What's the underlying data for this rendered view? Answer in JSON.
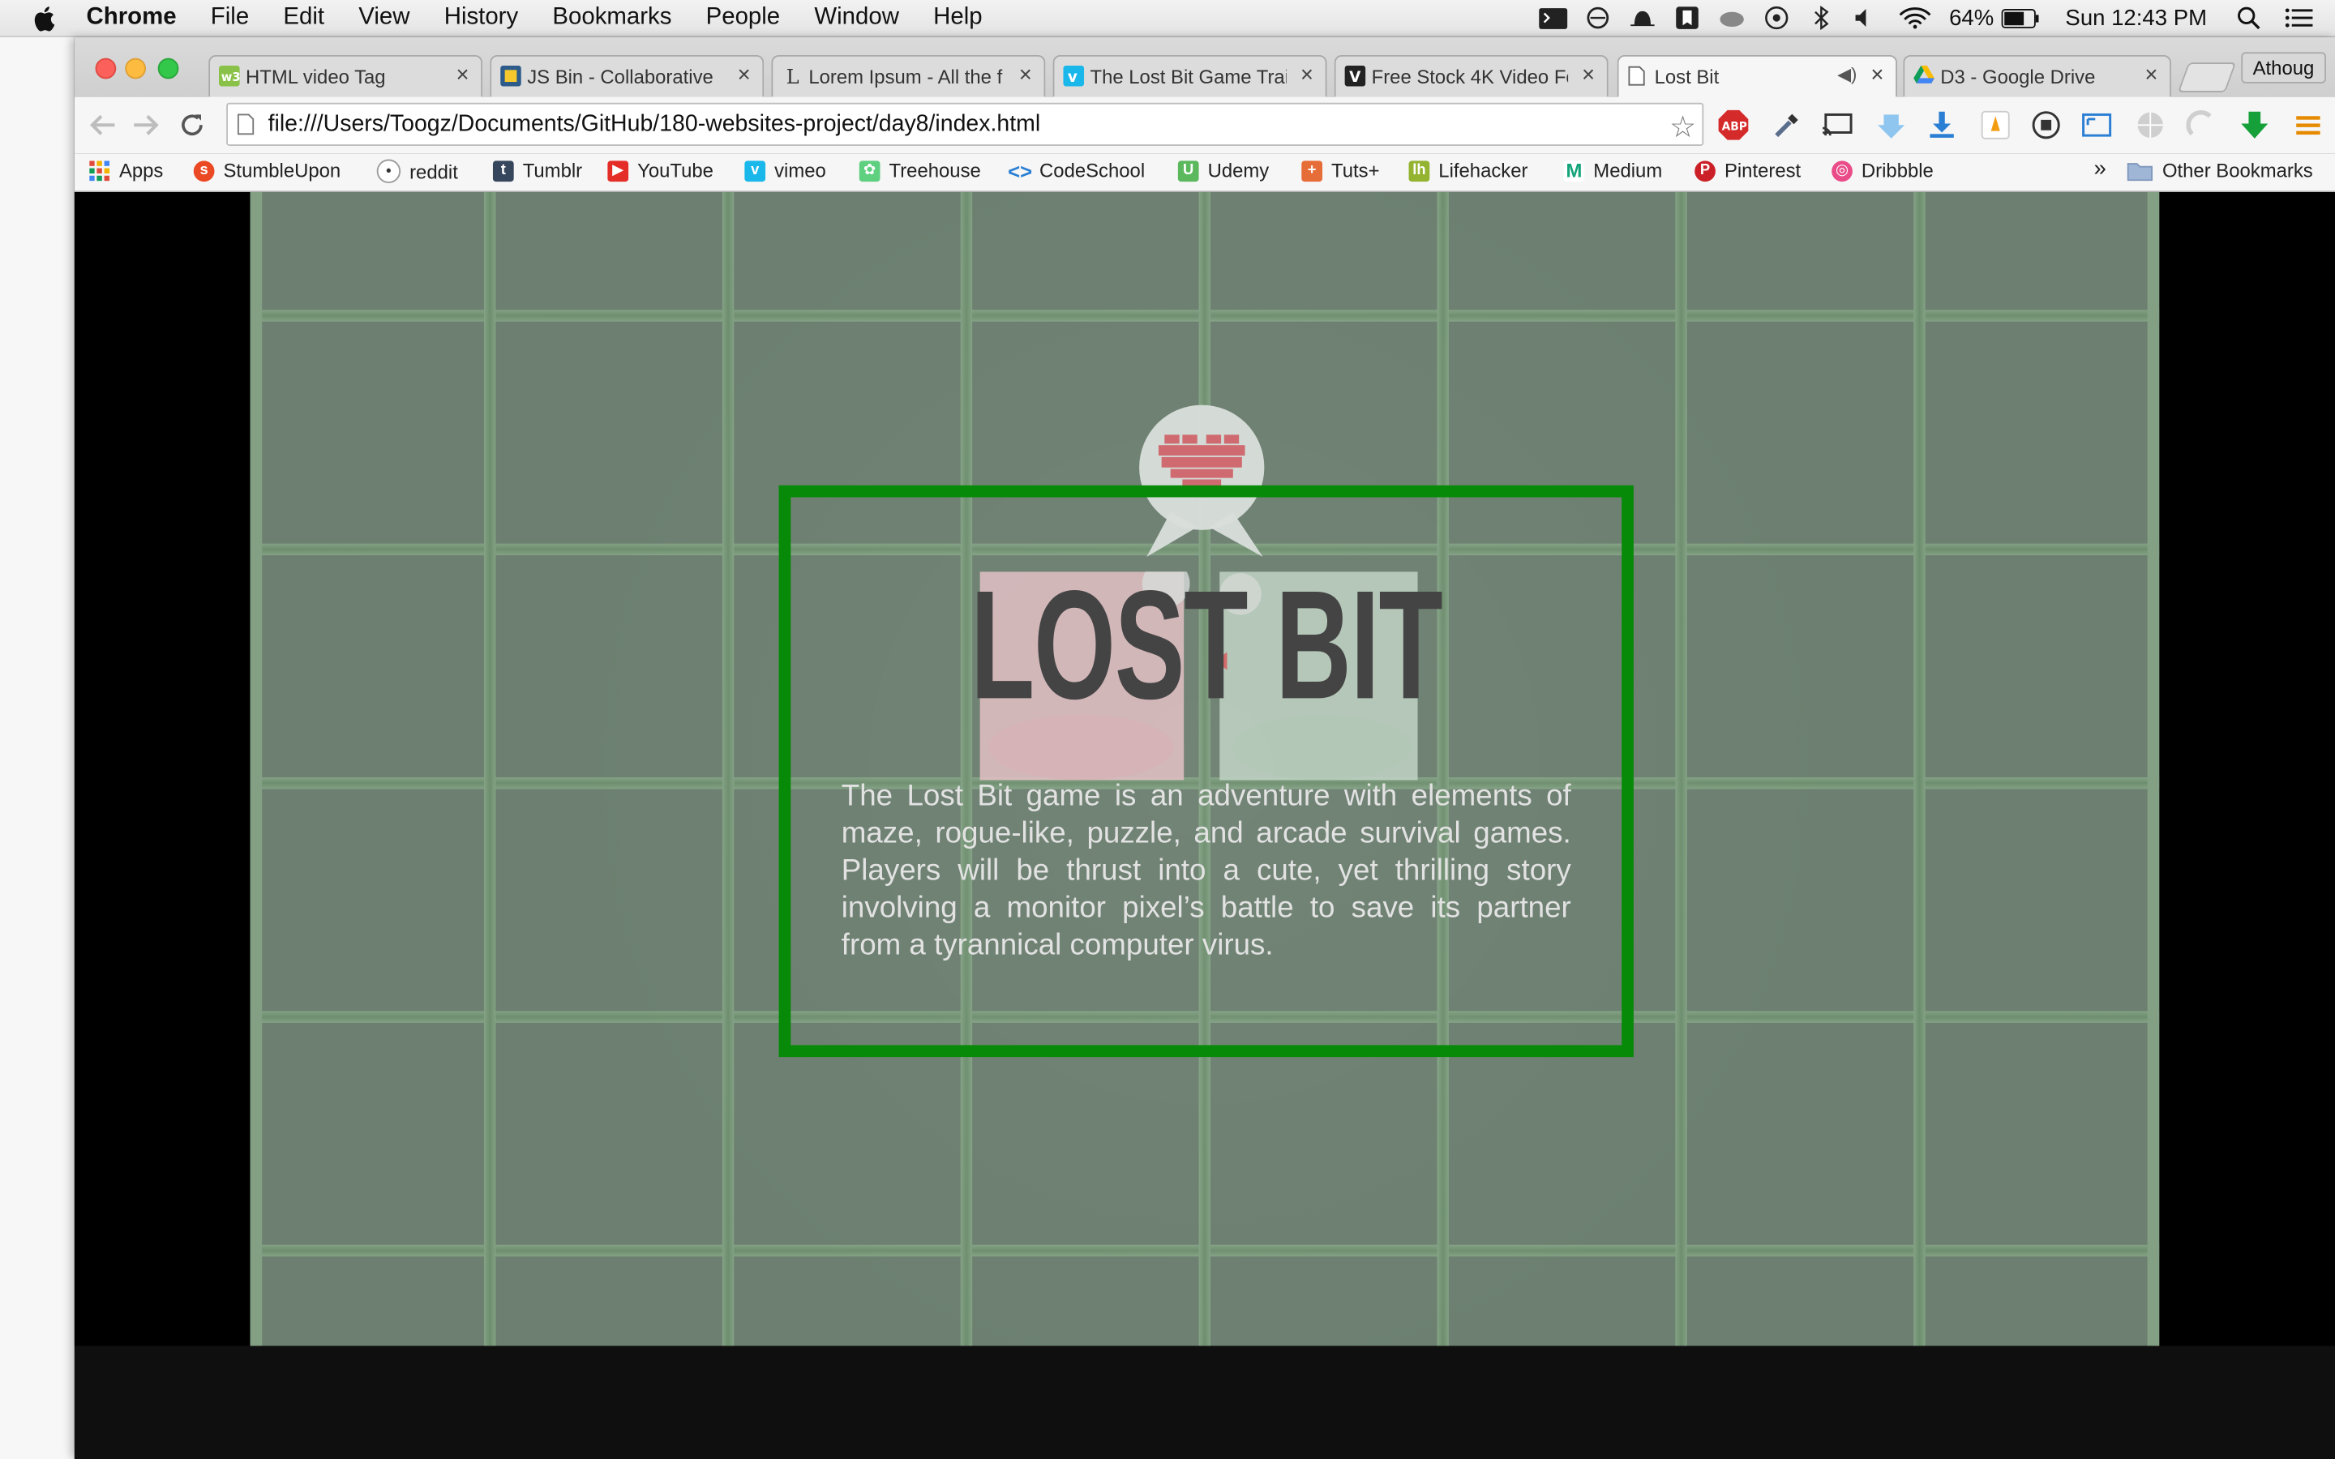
{
  "menubar": {
    "app": "Chrome",
    "items": [
      "File",
      "Edit",
      "View",
      "History",
      "Bookmarks",
      "People",
      "Window",
      "Help"
    ],
    "battery": "64%",
    "clock": "Sun 12:43 PM"
  },
  "tabs": [
    {
      "title": "HTML video Tag",
      "icon": "w3schools-icon"
    },
    {
      "title": "JS Bin - Collaborative",
      "icon": "jsbin-icon"
    },
    {
      "title": "Lorem Ipsum - All the f",
      "icon": "lipsum-icon"
    },
    {
      "title": "The Lost Bit Game Trai",
      "icon": "vimeo-icon"
    },
    {
      "title": "Free Stock 4K Video Fo",
      "icon": "videvo-icon"
    },
    {
      "title": "Lost Bit",
      "icon": "page-icon",
      "active": true
    },
    {
      "title": "D3 - Google Drive",
      "icon": "google-drive-icon"
    }
  ],
  "profile": "Athoug",
  "address": {
    "url": "file:///Users/Toogz/Documents/GitHub/180-websites-project/day8/index.html"
  },
  "bookmarks": {
    "items": [
      "Apps",
      "StumbleUpon",
      "reddit",
      "Tumblr",
      "YouTube",
      "vimeo",
      "Treehouse",
      "CodeSchool",
      "Udemy",
      "Tuts+",
      "Lifehacker",
      "Medium",
      "Pinterest",
      "Dribbble"
    ],
    "overflow": "»",
    "other": "Other Bookmarks"
  },
  "page": {
    "title": "LOST BIT",
    "description": "The Lost Bit game is an adventure with elements of maze, rogue-like, puzzle, and arcade survival games. Players will be thrust into a cute, yet thrilling story involving a monitor pixel’s battle to save its partner from a tyrannical computer virus.",
    "frame_color": "#068a07"
  }
}
